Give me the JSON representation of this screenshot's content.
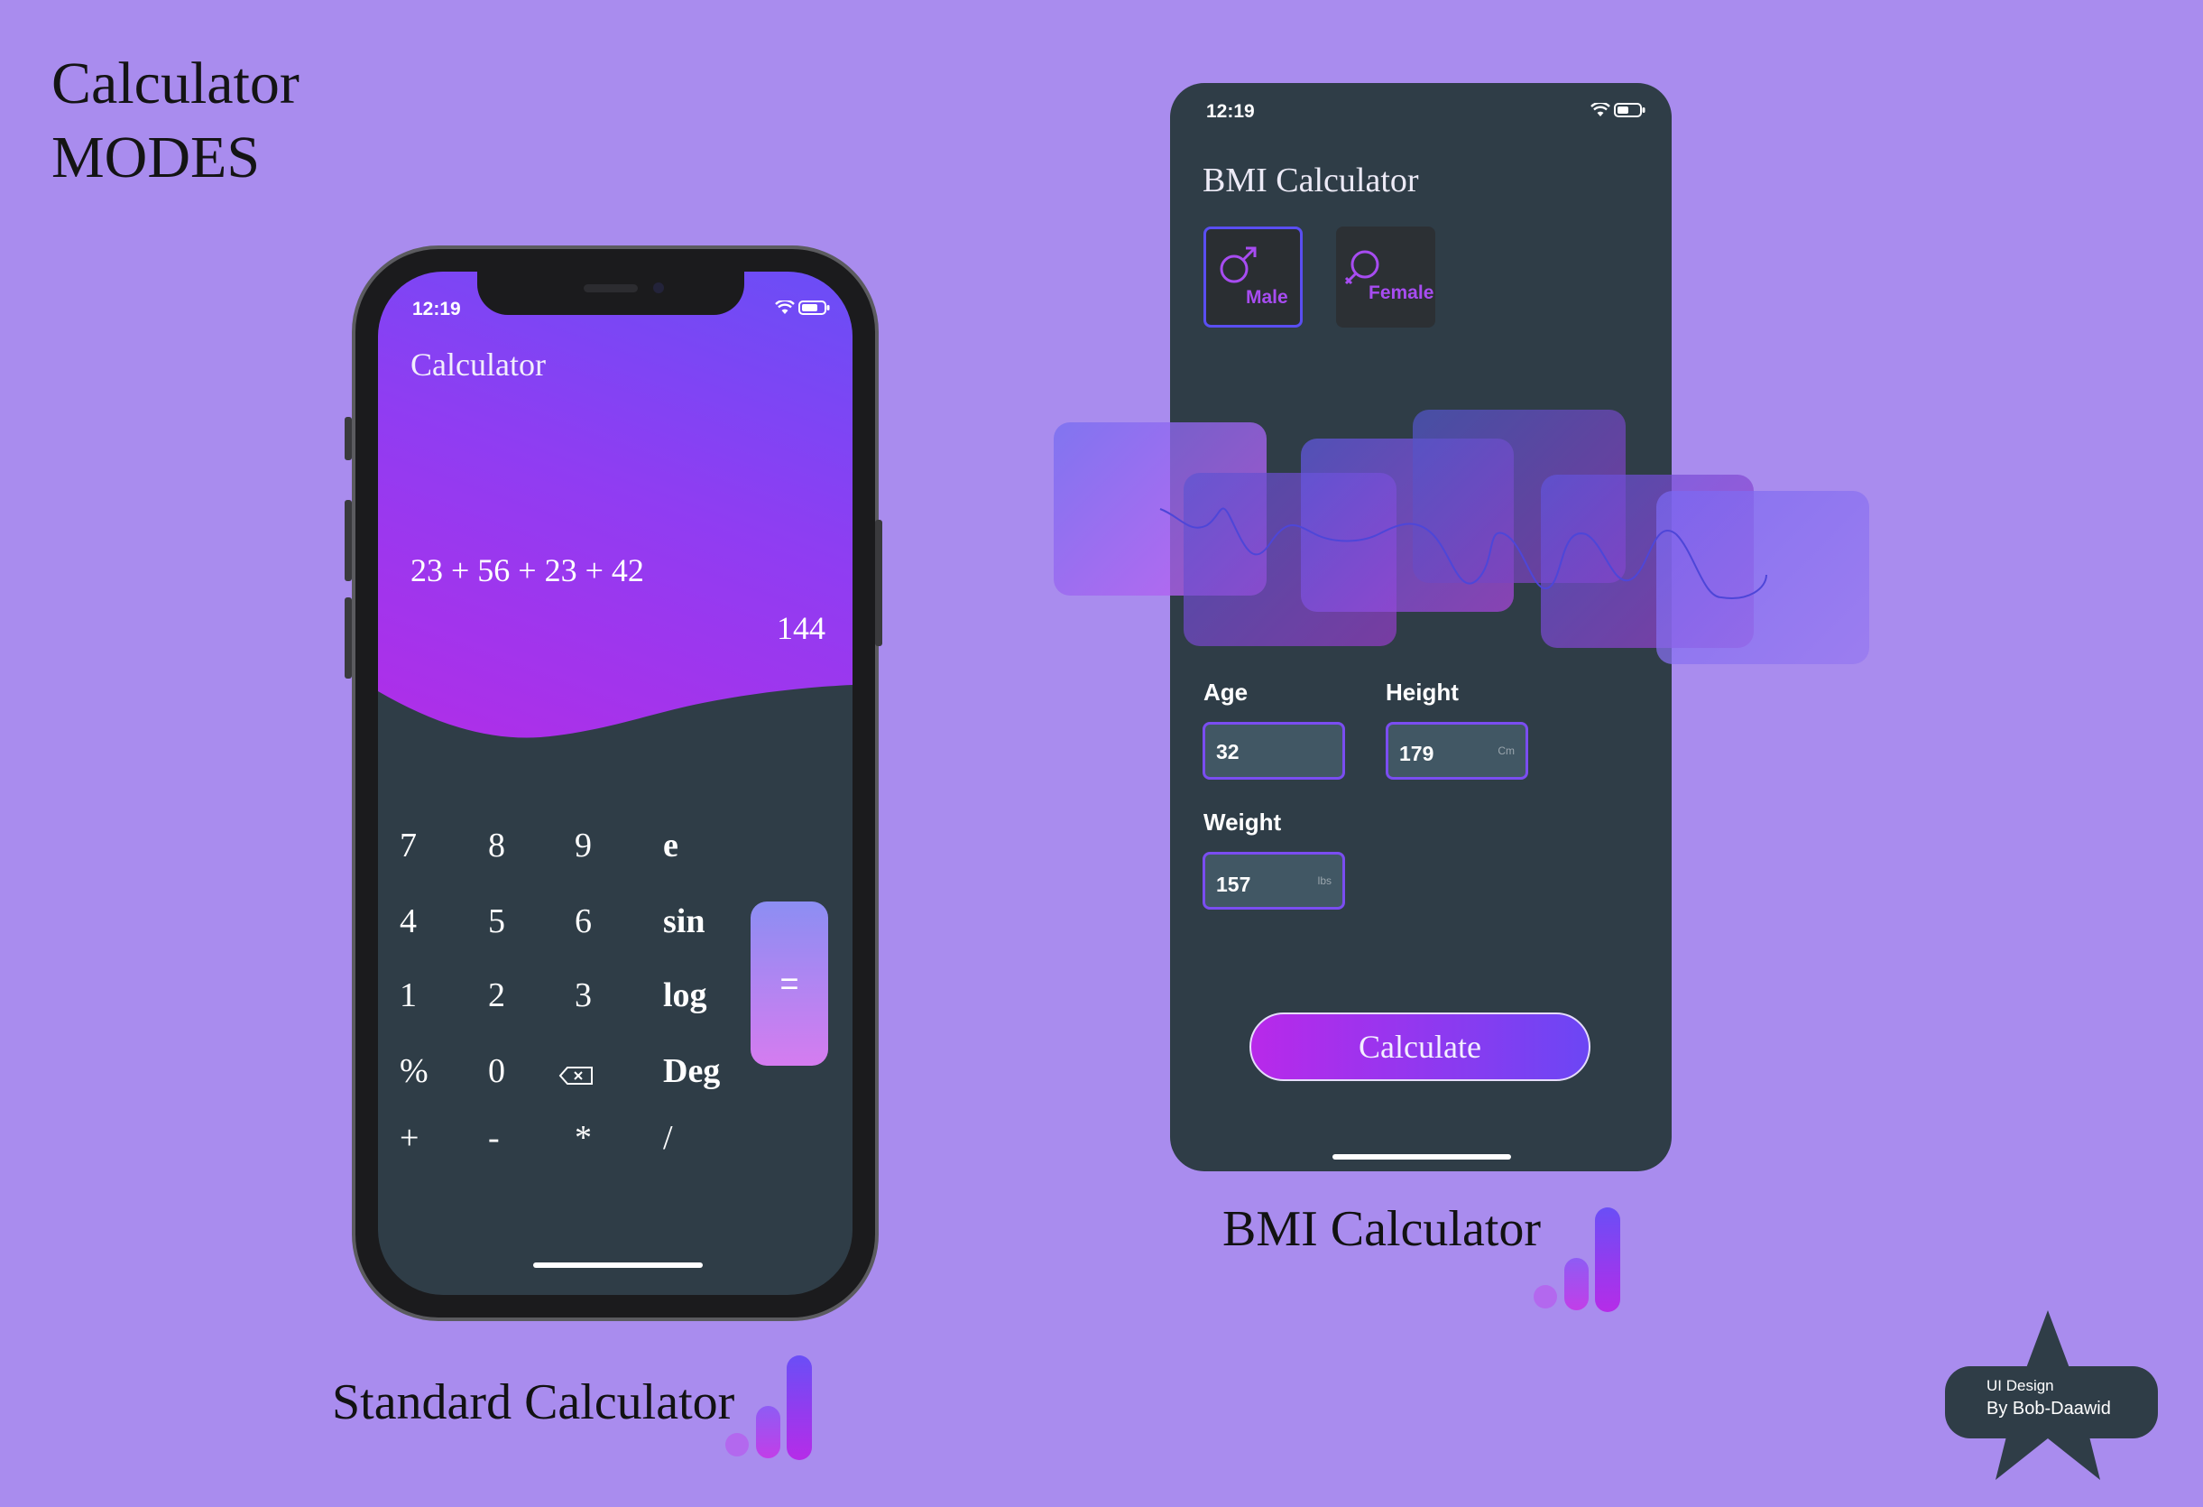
{
  "page": {
    "title_line1": "Calculator",
    "title_line2": "MODES",
    "standard_label": "Standard Calculator",
    "bmi_label": "BMI Calculator",
    "badge_line1": "UI Design",
    "badge_line2": "By Bob-Daawid"
  },
  "colors": {
    "background": "#a98cee",
    "phone_dark": "#2f3d47",
    "accent_purple": "#7a4df1",
    "accent_magenta": "#b829ea"
  },
  "standard_calculator": {
    "status_time": "12:19",
    "title": "Calculator",
    "expression": "23 + 56 + 23 + 42",
    "result": "144",
    "equals_label": "=",
    "keys": [
      [
        "7",
        "8",
        "9",
        "e"
      ],
      [
        "4",
        "5",
        "6",
        "sin"
      ],
      [
        "1",
        "2",
        "3",
        "log"
      ],
      [
        "%",
        "0",
        "backspace-icon",
        "Deg"
      ],
      [
        "+",
        "-",
        "*",
        "/"
      ]
    ]
  },
  "bmi_calculator": {
    "status_time": "12:19",
    "title": "BMI Calculator",
    "gender": {
      "male_label": "Male",
      "female_label": "Female",
      "selected": "Male"
    },
    "age": {
      "label": "Age",
      "value": "32"
    },
    "height": {
      "label": "Height",
      "value": "179",
      "unit": "Cm"
    },
    "weight": {
      "label": "Weight",
      "value": "157",
      "unit": "lbs"
    },
    "calculate_label": "Calculate"
  },
  "icons": [
    "wifi-icon",
    "battery-icon",
    "male-icon",
    "female-icon",
    "backspace-icon",
    "bar-chart-icon",
    "star-icon"
  ]
}
